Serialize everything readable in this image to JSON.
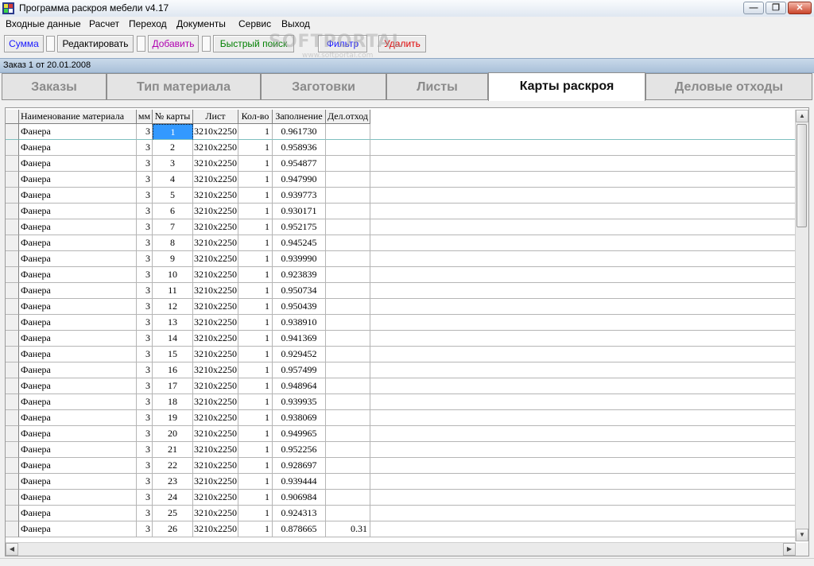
{
  "window": {
    "title": "Программа раскроя мебели v4.17"
  },
  "menu": [
    {
      "label": "Входные данные"
    },
    {
      "label": "Расчет"
    },
    {
      "label": "Переход"
    },
    {
      "label": "Документы"
    },
    {
      "label": "Сервис"
    },
    {
      "label": "Выход"
    }
  ],
  "toolbar": {
    "buttons": [
      {
        "label": "Сумма",
        "color": "#1a1aff"
      },
      {
        "label": "Редактировать",
        "color": "#000000"
      },
      {
        "label": "Добавить",
        "color": "#b000b0"
      },
      {
        "label": "Быстрый поиск",
        "color": "#008000"
      },
      {
        "label": "Фильтр",
        "color": "#1a1aff"
      },
      {
        "label": "Удалить",
        "color": "#e00000"
      }
    ]
  },
  "watermark": {
    "brand": "SOFTPORTAL",
    "url": "www.softportal.com"
  },
  "order": {
    "label": "Заказ 1 от 20.01.2008"
  },
  "tabs": [
    {
      "label": "Заказы"
    },
    {
      "label": "Тип материала"
    },
    {
      "label": "Заготовки"
    },
    {
      "label": "Листы"
    },
    {
      "label": "Карты раскроя"
    },
    {
      "label": "Деловые отходы"
    }
  ],
  "active_tab": "Карты раскроя",
  "table": {
    "columns": [
      "Наименование материала",
      "мм",
      "№ карты",
      "Лист",
      "Кол-во",
      "Заполнение",
      "Дел.отход"
    ],
    "rows": [
      [
        "Фанера",
        "3",
        "1",
        "3210x2250",
        "1",
        "0.961730",
        ""
      ],
      [
        "Фанера",
        "3",
        "2",
        "3210x2250",
        "1",
        "0.958936",
        ""
      ],
      [
        "Фанера",
        "3",
        "3",
        "3210x2250",
        "1",
        "0.954877",
        ""
      ],
      [
        "Фанера",
        "3",
        "4",
        "3210x2250",
        "1",
        "0.947990",
        ""
      ],
      [
        "Фанера",
        "3",
        "5",
        "3210x2250",
        "1",
        "0.939773",
        ""
      ],
      [
        "Фанера",
        "3",
        "6",
        "3210x2250",
        "1",
        "0.930171",
        ""
      ],
      [
        "Фанера",
        "3",
        "7",
        "3210x2250",
        "1",
        "0.952175",
        ""
      ],
      [
        "Фанера",
        "3",
        "8",
        "3210x2250",
        "1",
        "0.945245",
        ""
      ],
      [
        "Фанера",
        "3",
        "9",
        "3210x2250",
        "1",
        "0.939990",
        ""
      ],
      [
        "Фанера",
        "3",
        "10",
        "3210x2250",
        "1",
        "0.923839",
        ""
      ],
      [
        "Фанера",
        "3",
        "11",
        "3210x2250",
        "1",
        "0.950734",
        ""
      ],
      [
        "Фанера",
        "3",
        "12",
        "3210x2250",
        "1",
        "0.950439",
        ""
      ],
      [
        "Фанера",
        "3",
        "13",
        "3210x2250",
        "1",
        "0.938910",
        ""
      ],
      [
        "Фанера",
        "3",
        "14",
        "3210x2250",
        "1",
        "0.941369",
        ""
      ],
      [
        "Фанера",
        "3",
        "15",
        "3210x2250",
        "1",
        "0.929452",
        ""
      ],
      [
        "Фанера",
        "3",
        "16",
        "3210x2250",
        "1",
        "0.957499",
        ""
      ],
      [
        "Фанера",
        "3",
        "17",
        "3210x2250",
        "1",
        "0.948964",
        ""
      ],
      [
        "Фанера",
        "3",
        "18",
        "3210x2250",
        "1",
        "0.939935",
        ""
      ],
      [
        "Фанера",
        "3",
        "19",
        "3210x2250",
        "1",
        "0.938069",
        ""
      ],
      [
        "Фанера",
        "3",
        "20",
        "3210x2250",
        "1",
        "0.949965",
        ""
      ],
      [
        "Фанера",
        "3",
        "21",
        "3210x2250",
        "1",
        "0.952256",
        ""
      ],
      [
        "Фанера",
        "3",
        "22",
        "3210x2250",
        "1",
        "0.928697",
        ""
      ],
      [
        "Фанера",
        "3",
        "23",
        "3210x2250",
        "1",
        "0.939444",
        ""
      ],
      [
        "Фанера",
        "3",
        "24",
        "3210x2250",
        "1",
        "0.906984",
        ""
      ],
      [
        "Фанера",
        "3",
        "25",
        "3210x2250",
        "1",
        "0.924313",
        ""
      ],
      [
        "Фанера",
        "3",
        "26",
        "3210x2250",
        "1",
        "0.878665",
        "0.31"
      ]
    ]
  },
  "icons": {
    "app": "app-icon",
    "minimize": "minimize-icon",
    "maximize": "maximize-icon",
    "close": "close-icon"
  }
}
